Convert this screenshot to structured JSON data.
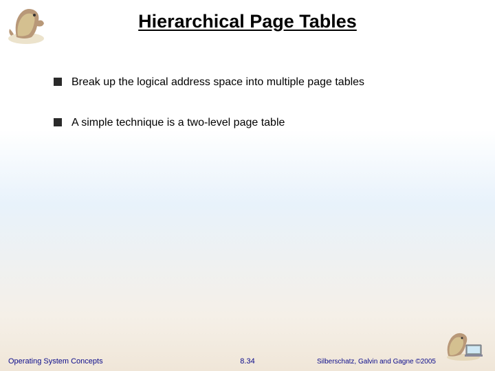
{
  "title": "Hierarchical Page Tables",
  "bullets": [
    {
      "text": "Break up the logical address space into multiple page tables"
    },
    {
      "text": "A simple technique is a two-level page table"
    }
  ],
  "footer": {
    "left": "Operating System Concepts",
    "center": "8.34",
    "right": "Silberschatz, Galvin and Gagne ©2005"
  },
  "icons": {
    "dino_top": "dinosaur-mascot",
    "dino_bottom": "dinosaur-mascot-computer"
  }
}
